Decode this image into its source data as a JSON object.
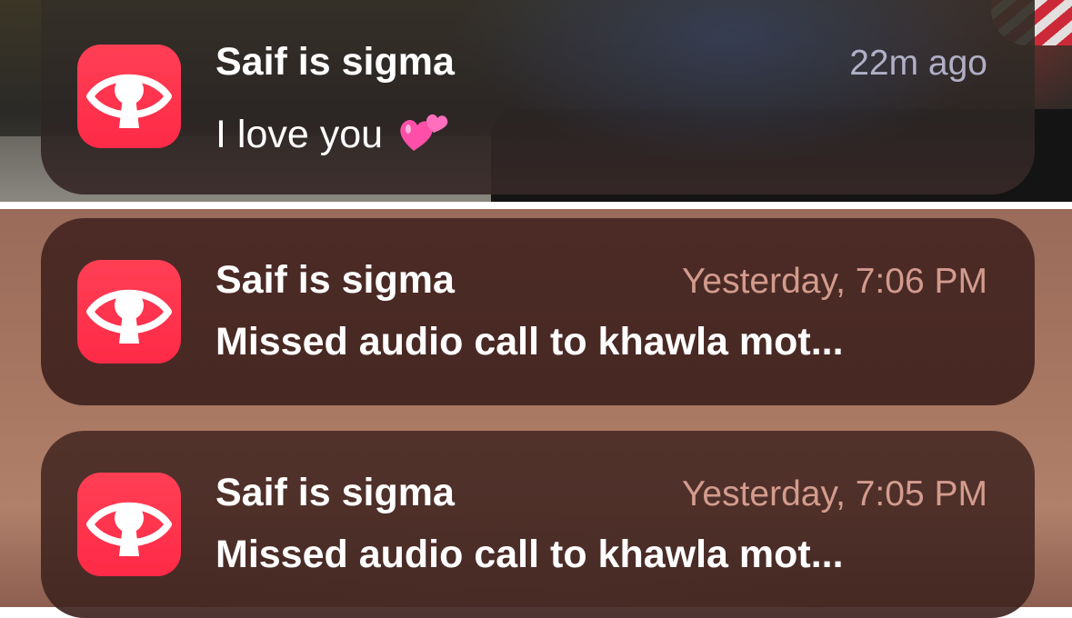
{
  "notifications": [
    {
      "app_icon": "eye-keyhole-icon",
      "sender": "Saif is sigma",
      "time": "22m ago",
      "message": "I love you",
      "emoji": "two-hearts-icon"
    },
    {
      "app_icon": "eye-keyhole-icon",
      "sender": "Saif is sigma",
      "time": "Yesterday, 7:06 PM",
      "message": "Missed audio call to khawla mot..."
    },
    {
      "app_icon": "eye-keyhole-icon",
      "sender": "Saif is sigma",
      "time": "Yesterday, 7:05 PM",
      "message": "Missed audio call to khawla mot..."
    }
  ],
  "colors": {
    "app_icon": "#ff2d4a",
    "hearts": "#ff4fa8"
  }
}
